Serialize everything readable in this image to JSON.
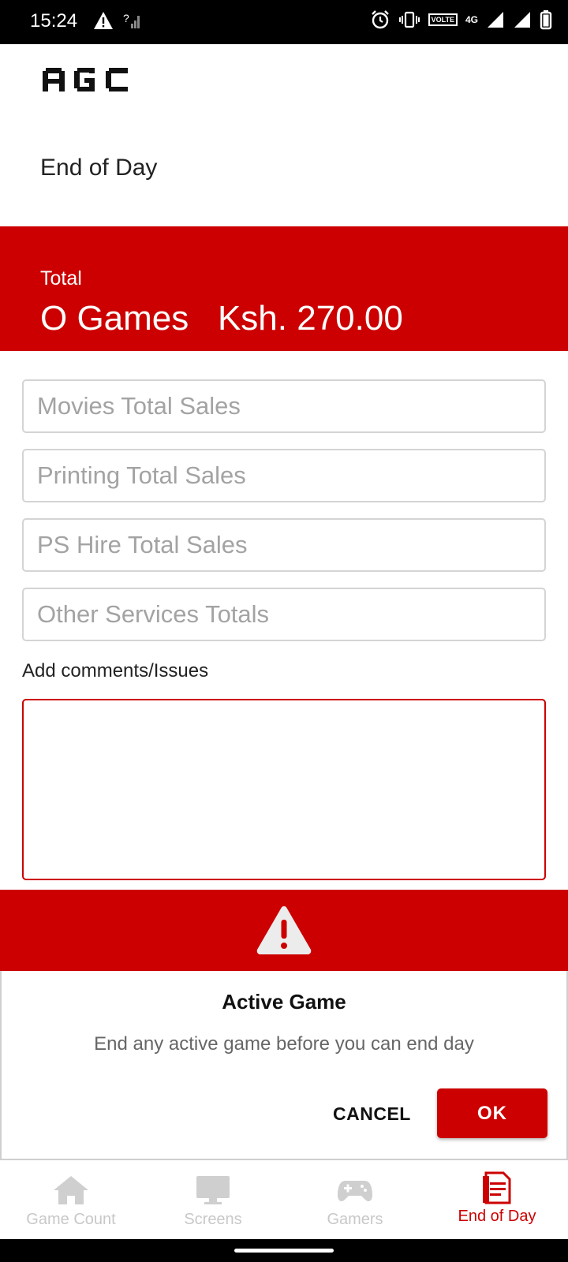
{
  "status_bar": {
    "time": "15:24",
    "icons_left": [
      "warning-icon",
      "no-signal-icon"
    ],
    "icons_right": [
      "alarm-icon",
      "vibrate-icon",
      "volte-icon",
      "4g-icon",
      "signal-icon",
      "signal-icon",
      "battery-icon"
    ],
    "volte_text": "VOLTE",
    "network_text": "4G"
  },
  "app": {
    "logo_text": "AGC",
    "page_title": "End of Day"
  },
  "total_banner": {
    "label": "Total",
    "summary": "O Games   Ksh. 270.00",
    "color": "#cc0000"
  },
  "form": {
    "movies_placeholder": "Movies Total Sales",
    "printing_placeholder": "Printing Total Sales",
    "ps_hire_placeholder": "PS Hire Total Sales",
    "other_placeholder": "Other Services Totals",
    "comments_label": "Add comments/Issues",
    "comments_value": ""
  },
  "dialog": {
    "icon": "warning-icon",
    "title": "Active Game",
    "message": "End any active game before you can end day",
    "cancel_label": "CANCEL",
    "ok_label": "OK"
  },
  "bottom_nav": {
    "items": [
      {
        "label": "Game Count",
        "icon": "home-icon",
        "active": false
      },
      {
        "label": "Screens",
        "icon": "monitor-icon",
        "active": false
      },
      {
        "label": "Gamers",
        "icon": "gamepad-icon",
        "active": false
      },
      {
        "label": "End of Day",
        "icon": "document-icon",
        "active": true
      }
    ]
  }
}
